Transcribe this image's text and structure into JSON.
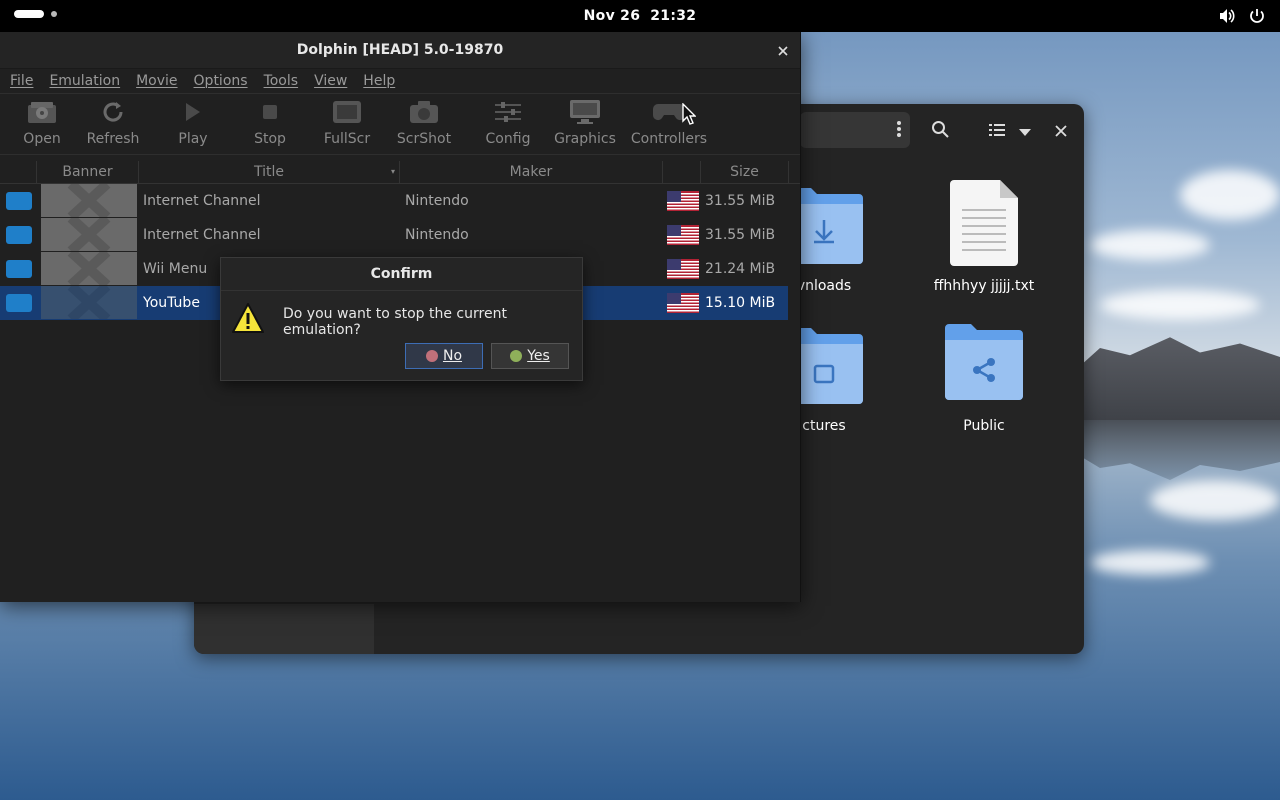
{
  "topbar": {
    "date": "Nov 26",
    "time": "21:32"
  },
  "files": {
    "items": [
      {
        "label": "vnloads",
        "icon": "download-folder-icon"
      },
      {
        "label": "ffhhhyy jjjjj.txt",
        "icon": "text-file-icon"
      },
      {
        "label": "ctures",
        "icon": "pictures-folder-icon"
      },
      {
        "label": "Public",
        "icon": "public-folder-icon"
      }
    ]
  },
  "dolphin": {
    "title": "Dolphin [HEAD] 5.0-19870",
    "menu": [
      "File",
      "Emulation",
      "Movie",
      "Options",
      "Tools",
      "View",
      "Help"
    ],
    "toolbar": [
      "Open",
      "Refresh",
      "Play",
      "Stop",
      "FullScr",
      "ScrShot",
      "Config",
      "Graphics",
      "Controllers"
    ],
    "columns": {
      "banner": "Banner",
      "title": "Title",
      "maker": "Maker",
      "size": "Size"
    },
    "games": [
      {
        "title": "Internet Channel",
        "maker": "Nintendo",
        "size": "31.55 MiB"
      },
      {
        "title": "Internet Channel",
        "maker": "Nintendo",
        "size": "31.55 MiB"
      },
      {
        "title": "Wii Menu",
        "maker": "",
        "size": "21.24 MiB"
      },
      {
        "title": "YouTube",
        "maker": "",
        "size": "15.10 MiB"
      }
    ]
  },
  "dialog": {
    "title": "Confirm",
    "message": "Do you want to stop the current emulation?",
    "no_label": "No",
    "yes_label": "Yes"
  },
  "colors": {
    "selection": "#173c73",
    "folder": "#62a0ea",
    "accent": "#3d6db5"
  }
}
